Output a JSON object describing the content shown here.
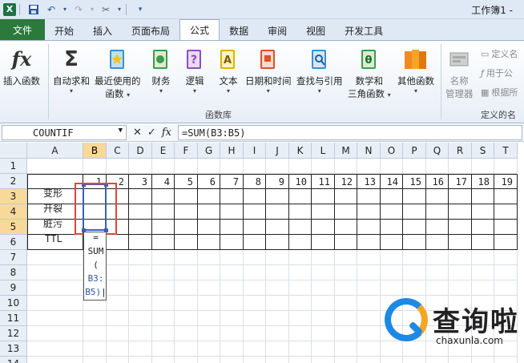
{
  "window": {
    "title": "工作簿1 -"
  },
  "tabs": [
    {
      "label": "文件"
    },
    {
      "label": "开始"
    },
    {
      "label": "插入"
    },
    {
      "label": "页面布局"
    },
    {
      "label": "公式"
    },
    {
      "label": "数据"
    },
    {
      "label": "审阅"
    },
    {
      "label": "视图"
    },
    {
      "label": "开发工具"
    }
  ],
  "ribbon": {
    "insert_function": "插入函数",
    "autosum": "自动求和",
    "recent_line1": "最近使用的",
    "recent_line2": "函数",
    "financial": "财务",
    "logical": "逻辑",
    "text": "文本",
    "datetime": "日期和时间",
    "lookup": "查找与引用",
    "math_line1": "数学和",
    "math_line2": "三角函数",
    "other": "其他函数",
    "name_mgr_line1": "名称",
    "name_mgr_line2": "管理器",
    "define_name": "定义名",
    "use_in_formula": "用于公",
    "create_from_sel": "根据所",
    "group_library": "函数库",
    "group_defined": "定义的名",
    "arrow": "▾"
  },
  "formula_bar": {
    "name_box": "COUNTIF",
    "fx": "fx",
    "formula": "=SUM(B3:B5)"
  },
  "grid": {
    "columns": [
      "A",
      "B",
      "C",
      "D",
      "E",
      "F",
      "G",
      "H",
      "I",
      "J",
      "K",
      "L",
      "M",
      "N",
      "O",
      "P",
      "Q",
      "R",
      "S",
      "T"
    ],
    "rows": [
      "1",
      "2",
      "3",
      "4",
      "5",
      "6",
      "7",
      "8",
      "9",
      "10",
      "11",
      "12",
      "13",
      "14"
    ],
    "row2_values": [
      "1",
      "2",
      "3",
      "4",
      "5",
      "6",
      "7",
      "8",
      "9",
      "10",
      "11",
      "12",
      "13",
      "14",
      "15",
      "16",
      "17",
      "18",
      "19"
    ],
    "labels": {
      "r3": "变形",
      "r4": "开裂",
      "r5": "脏污",
      "r6": "TTL"
    },
    "editing": {
      "line1": "=",
      "line2": "SUM",
      "line3": "(",
      "line4": "B3:",
      "line5": "B5)"
    }
  },
  "watermark": {
    "brand": "查询啦",
    "url": "chaxunla.com"
  },
  "colors": {
    "file_tab": "#2b7a3c",
    "selection": "#3c5fb8",
    "highlight": "#e2453b",
    "header_selected": "#f9d99a"
  }
}
